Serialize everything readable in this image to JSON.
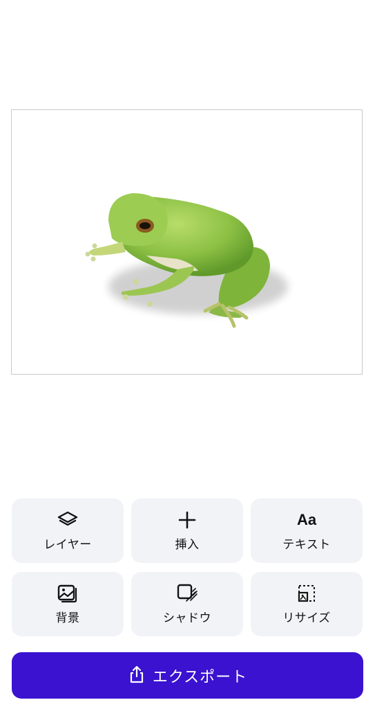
{
  "canvas": {
    "image_subject": "green tree frog"
  },
  "tools": [
    {
      "label": "レイヤー",
      "icon": "layers-icon"
    },
    {
      "label": "挿入",
      "icon": "plus-icon"
    },
    {
      "label": "テキスト",
      "icon": "text-icon",
      "glyph": "Aa"
    },
    {
      "label": "背景",
      "icon": "background-image-icon"
    },
    {
      "label": "シャドウ",
      "icon": "shadow-icon"
    },
    {
      "label": "リサイズ",
      "icon": "resize-icon"
    }
  ],
  "export": {
    "label": "エクスポート",
    "icon": "share-icon"
  },
  "colors": {
    "accent": "#3a12cf",
    "tile_bg": "#f1f3f7"
  }
}
